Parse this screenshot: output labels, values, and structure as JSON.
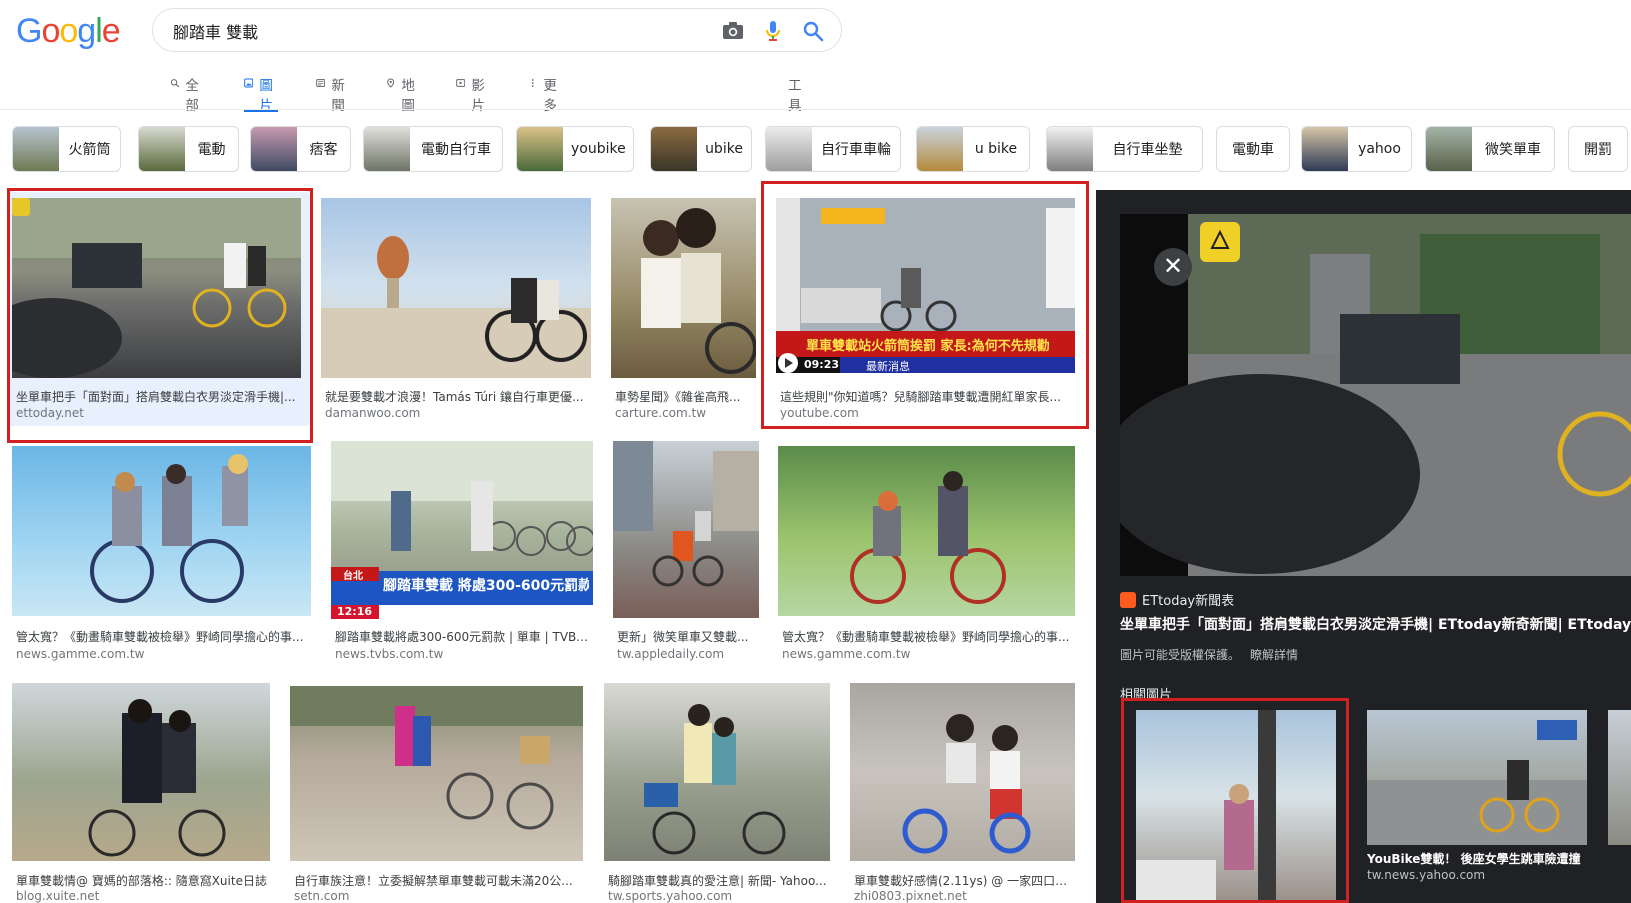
{
  "logo": "Google",
  "search": {
    "query": "腳踏車 雙載",
    "camera_icon": "camera-icon",
    "mic_icon": "microphone-icon",
    "search_icon": "magnifier-icon"
  },
  "tabs": {
    "all": "全部",
    "images": "圖片",
    "news": "新聞",
    "maps": "地圖",
    "videos": "影片",
    "more": "更多",
    "tools": "工具"
  },
  "chips": [
    "火箭筒",
    "電動",
    "痞客",
    "電動自行車",
    "youbike",
    "ubike",
    "自行車車輪",
    "u bike",
    "自行車坐墊",
    "電動車",
    "yahoo",
    "微笑單車",
    "開罰"
  ],
  "results": [
    {
      "title": "坐單車把手「面對面」搭肩雙載白衣男淡定滑手機|...",
      "source": "ettoday.net"
    },
    {
      "title": "就是要雙載才浪漫！Tamás Túri 鑲自行車更優...",
      "source": "damanwoo.com"
    },
    {
      "title": "車勢星聞》《雜雀高飛...",
      "source": "carture.com.tw"
    },
    {
      "title": "這些規則\"你知道嗎？兒騎腳踏車雙載遭開紅單家長...",
      "source": "youtube.com"
    },
    {
      "title": "管太寬？《動畫騎車雙載被檢舉》野崎同學擔心的事...",
      "source": "news.gamme.com.tw"
    },
    {
      "title": "腳踏車雙載將處300-600元罰款 | 單車 | TVBS...",
      "source": "news.tvbs.com.tw"
    },
    {
      "title": "更新」微笑單車又雙載...",
      "source": "tw.appledaily.com"
    },
    {
      "title": "管太寬？《動畫騎車雙載被檢舉》野崎同學擔心的事...",
      "source": "news.gamme.com.tw"
    },
    {
      "title": "單車雙載情@ 寶媽的部落格:: 隨意窩Xuite日誌",
      "source": "blog.xuite.net"
    },
    {
      "title": "自行車族注意！立委擬解禁單車雙載可載未滿20公...",
      "source": "setn.com"
    },
    {
      "title": "騎腳踏車雙載真的愛注意| 新聞- Yahoo...",
      "source": "tw.sports.yahoo.com"
    },
    {
      "title": "單車雙載好感情(2.11ys) @ 一家四口簡...",
      "source": "zhi0803.pixnet.net"
    }
  ],
  "thumb_text": {
    "news_banner": "單車雙載站火箭筒挨罰 家長:為何不先規勸",
    "news_sub": "最新消息",
    "news_time": "09:23",
    "tvbs_banner": "腳踏車雙載 將處300-600元罰款",
    "tvbs_city": "台北",
    "tvbs_time": "12:16"
  },
  "panel": {
    "source_name": "ETtoday新聞表",
    "title": "坐單車把手「面對面」搭肩雙載白衣男淡定滑手機| ETtoday新奇新聞| ETtoday新聞雲",
    "copyright": "圖片可能受版權保護。",
    "learn_more": "瞭解詳情",
    "related_heading": "相關圖片",
    "related": [
      {
        "caption": "",
        "source": ""
      },
      {
        "caption": "YouBike雙載！ 後座女學生跳車險遭撞",
        "source": "tw.news.yahoo.com"
      }
    ]
  }
}
